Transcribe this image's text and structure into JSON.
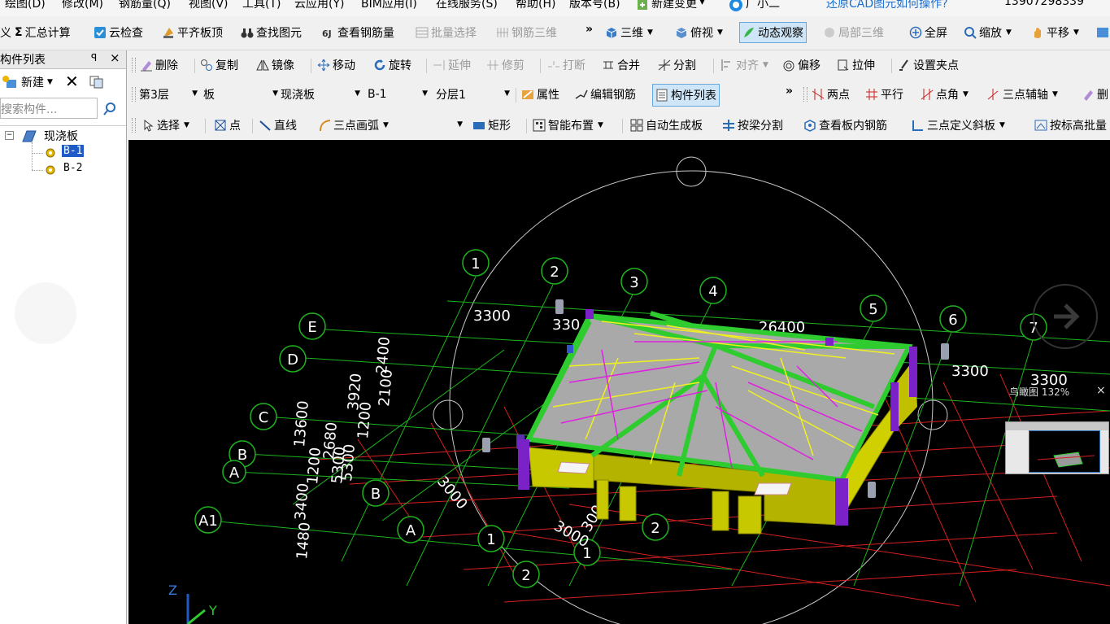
{
  "menu": [
    "绘图(D)",
    "修改(M)",
    "钢筋量(Q)",
    "视图(V)",
    "工具(T)",
    "云应用(Y)",
    "BIM应用(I)",
    "在线服务(S)",
    "帮助(H)",
    "版本号(B)",
    "新建变更",
    "广小二",
    "还原CAD图元如何操作?",
    "13907298339"
  ],
  "toolbar1": {
    "sigma": "Σ",
    "summary_calc": "汇总计算",
    "cloud_check": "云检查",
    "align_slab_top": "平齐板顶",
    "find_element": "查找图元",
    "view_rebar_qty": "查看钢筋量",
    "batch_select": "批量选择",
    "rebar_3d": "钢筋三维",
    "more": "»",
    "three_d": "三维",
    "top_view": "俯视",
    "dynamic_observe": "动态观察",
    "partial_3d": "局部三维",
    "full_screen": "全屏",
    "zoom": "缩放",
    "pan": "平移"
  },
  "left_panel": {
    "title": "构件列表",
    "pin": "ꟼ",
    "close": "×",
    "new_btn": "新建",
    "search_placeholder": "搜索构件...",
    "tree_root": "现浇板",
    "items": [
      "B-1",
      "B-2"
    ],
    "collapse": "−"
  },
  "toolbar2": {
    "delete": "删除",
    "copy": "复制",
    "mirror": "镜像",
    "move": "移动",
    "rotate": "旋转",
    "extend": "延伸",
    "trim": "修剪",
    "break": "打断",
    "merge": "合并",
    "split": "分割",
    "align": "对齐",
    "offset": "偏移",
    "stretch": "拉伸",
    "set_grip": "设置夹点"
  },
  "toolbar3": {
    "floor": "第3层",
    "type": "板",
    "subtype": "现浇板",
    "component": "B-1",
    "layer": "分层1",
    "properties": "属性",
    "edit_rebar": "编辑钢筋",
    "component_list": "构件列表",
    "more": "»",
    "two_points": "两点",
    "parallel": "平行",
    "point_angle": "点角",
    "three_point_axis": "三点辅轴",
    "delete_short": "删"
  },
  "toolbar4": {
    "select": "选择",
    "point": "点",
    "line": "直线",
    "arc3": "三点画弧",
    "rect": "矩形",
    "smart_place": "智能布置",
    "auto_slab": "自动生成板",
    "split_by_beam": "按梁分割",
    "view_slab_rebar": "查看板内钢筋",
    "three_point_slope": "三点定义斜板",
    "by_elev": "按标高批量"
  },
  "viewport": {
    "nav_label": "鸟瞰图 132%",
    "nav_close": "×",
    "axis_z": "Z",
    "axis_y": "Y",
    "grid_numbers": [
      "1",
      "2",
      "3",
      "4",
      "5",
      "6",
      "7"
    ],
    "grid_letters": [
      "E",
      "D",
      "C",
      "B",
      "A",
      "A1"
    ],
    "dims_top": [
      "3300",
      "330",
      "26400",
      "3300",
      "3300"
    ],
    "dims_left": [
      "2400",
      "2100",
      "3920",
      "1200",
      "13600",
      "2680",
      "5300",
      "1200",
      "3400",
      "1480",
      "5300"
    ],
    "dims_front": [
      "3000",
      "3000",
      "300"
    ],
    "sub_labels": [
      "B",
      "A",
      "1",
      "2",
      "1",
      "2"
    ],
    "colors": {
      "grid_green": "#1db41d",
      "grid_red": "#d61f1f",
      "beam": "#2ecc2e",
      "slab": "#a9a9a9",
      "wall": "#c8c800",
      "column": "#7a22c8",
      "rebar_yellow": "#f0f020",
      "rebar_magenta": "#e020e0"
    }
  }
}
